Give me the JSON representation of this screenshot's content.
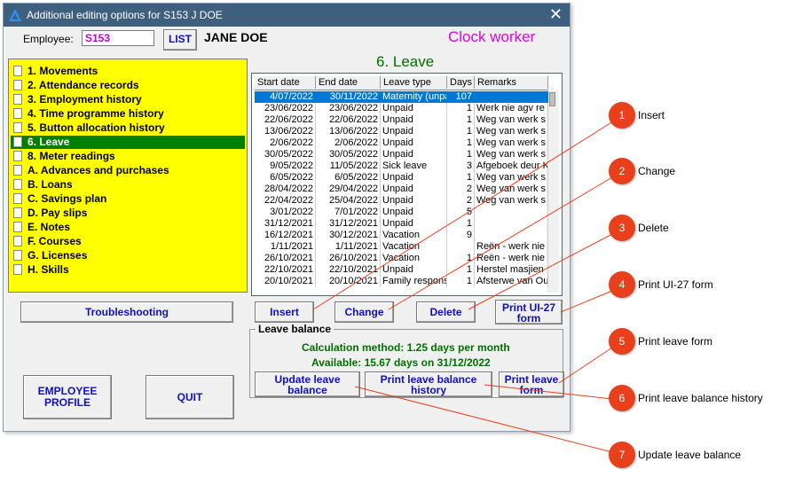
{
  "window": {
    "title": "Additional editing options for S153 J DOE",
    "close": "✕"
  },
  "employee": {
    "label": "Employee:",
    "code": "S153",
    "list_button": "LIST",
    "name": "JANE DOE",
    "type": "Clock worker"
  },
  "section_title": "6. Leave",
  "menu": [
    {
      "label": "1. Movements"
    },
    {
      "label": "2. Attendance records"
    },
    {
      "label": "3. Employment history"
    },
    {
      "label": "4. Time programme history"
    },
    {
      "label": "5. Button allocation history"
    },
    {
      "label": "6. Leave",
      "selected": true
    },
    {
      "label": "8. Meter readings"
    },
    {
      "label": "A. Advances and purchases"
    },
    {
      "label": "B. Loans"
    },
    {
      "label": "C. Savings plan"
    },
    {
      "label": "D. Pay slips"
    },
    {
      "label": "E. Notes"
    },
    {
      "label": "F. Courses"
    },
    {
      "label": "G. Licenses"
    },
    {
      "label": "H. Skills"
    }
  ],
  "table": {
    "headers": [
      "Start date",
      "End date",
      "Leave type",
      "Days",
      "Remarks"
    ],
    "rows": [
      [
        "4/07/2022",
        "30/11/2022",
        "Maternity (unpa",
        "107",
        ""
      ],
      [
        "23/06/2022",
        "23/06/2022",
        "Unpaid",
        "1",
        "Werk nie agv re"
      ],
      [
        "22/06/2022",
        "22/06/2022",
        "Unpaid",
        "1",
        "Weg van werk s"
      ],
      [
        "13/06/2022",
        "13/06/2022",
        "Unpaid",
        "1",
        "Weg van werk s"
      ],
      [
        "2/06/2022",
        "2/06/2022",
        "Unpaid",
        "1",
        "Weg van werk s"
      ],
      [
        "30/05/2022",
        "30/05/2022",
        "Unpaid",
        "1",
        "Weg van werk s"
      ],
      [
        "9/05/2022",
        "11/05/2022",
        "Sick leave",
        "3",
        "Afgeboek deur K"
      ],
      [
        "6/05/2022",
        "6/05/2022",
        "Unpaid",
        "1",
        "Weg van werk s"
      ],
      [
        "28/04/2022",
        "29/04/2022",
        "Unpaid",
        "2",
        "Weg van werk s"
      ],
      [
        "22/04/2022",
        "25/04/2022",
        "Unpaid",
        "2",
        "Weg van werk s"
      ],
      [
        "3/01/2022",
        "7/01/2022",
        "Unpaid",
        "5",
        ""
      ],
      [
        "31/12/2021",
        "31/12/2021",
        "Unpaid",
        "1",
        ""
      ],
      [
        "16/12/2021",
        "30/12/2021",
        "Vacation",
        "9",
        ""
      ],
      [
        "1/11/2021",
        "1/11/2021",
        "Vacation",
        "",
        "Reën - werk nie"
      ],
      [
        "26/10/2021",
        "26/10/2021",
        "Vacation",
        "1",
        "Reën - werk nie"
      ],
      [
        "22/10/2021",
        "22/10/2021",
        "Unpaid",
        "1",
        "Herstel masjien"
      ],
      [
        "20/10/2021",
        "20/10/2021",
        "Family responsi",
        "1",
        "Afsterwe van Ou"
      ]
    ]
  },
  "buttons": {
    "insert": "Insert",
    "change": "Change",
    "delete": "Delete",
    "print_ui27_l1": "Print UI-27",
    "print_ui27_l2": "form",
    "troubleshooting": "Troubleshooting",
    "employee_profile_l1": "EMPLOYEE",
    "employee_profile_l2": "PROFILE",
    "quit": "QUIT",
    "update_balance_l1": "Update leave",
    "update_balance_l2": "balance",
    "print_balance_history_l1": "Print leave balance",
    "print_balance_history_l2": "history",
    "print_leave_form_l1": "Print leave",
    "print_leave_form_l2": "form"
  },
  "leave_balance": {
    "title": "Leave balance",
    "calculation": "Calculation method:  1.25 days per month",
    "available": "Available: 15.67 days on 31/12/2022"
  },
  "callouts": [
    {
      "num": "1",
      "text": "Insert"
    },
    {
      "num": "2",
      "text": "Change"
    },
    {
      "num": "3",
      "text": "Delete"
    },
    {
      "num": "4",
      "text": "Print UI-27 form"
    },
    {
      "num": "5",
      "text": "Print leave form"
    },
    {
      "num": "6",
      "text": "Print leave balance history"
    },
    {
      "num": "7",
      "text": "Update leave balance"
    }
  ],
  "colors": {
    "accent_green": "#008000",
    "menu_bg": "#ffff00",
    "callout": "#e8401c",
    "button_text": "#1010c0"
  }
}
